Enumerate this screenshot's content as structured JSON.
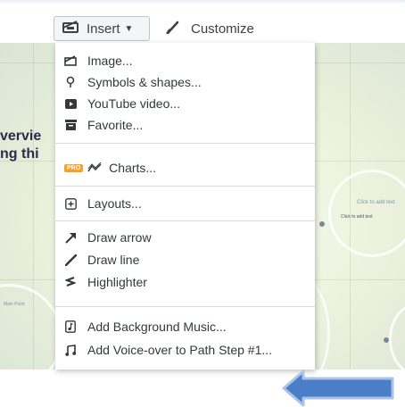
{
  "toolbar": {
    "insert_label": "Insert",
    "customize_label": "Customize"
  },
  "canvas": {
    "title_line1": "vervie",
    "title_line2": "ng thi",
    "click_to_add_text": "Click to add text",
    "main_point": "Main Point"
  },
  "menu": {
    "items": [
      {
        "label": "Image...",
        "icon": "image-icon"
      },
      {
        "label": "Symbols & shapes...",
        "icon": "symbols-icon"
      },
      {
        "label": "YouTube video...",
        "icon": "youtube-icon"
      },
      {
        "label": "Favorite...",
        "icon": "favorite-icon"
      },
      {
        "label": "Charts...",
        "icon": "chart-icon",
        "badge": "PRO"
      },
      {
        "label": "Layouts...",
        "icon": "layouts-icon"
      },
      {
        "label": "Draw arrow",
        "icon": "arrow-icon"
      },
      {
        "label": "Draw line",
        "icon": "line-icon"
      },
      {
        "label": "Highlighter",
        "icon": "highlighter-icon"
      },
      {
        "label": "Add Background Music...",
        "icon": "music-file-icon"
      },
      {
        "label": "Add Voice-over to Path Step #1...",
        "icon": "music-note-icon"
      }
    ]
  },
  "colors": {
    "pro_badge": "#f0a326",
    "arrow_fill": "#4a7fc8",
    "arrow_border": "#a9c4e4"
  }
}
